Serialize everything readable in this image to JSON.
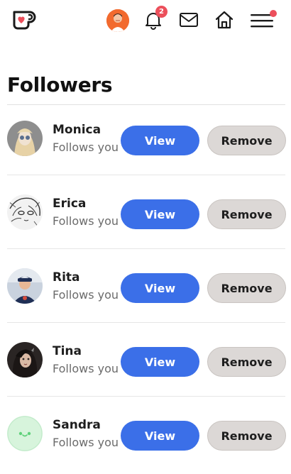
{
  "header": {
    "notification_count": "2",
    "icons": [
      "ko-fi-logo-icon",
      "profile-avatar-icon",
      "bell-icon",
      "mail-icon",
      "home-icon",
      "menu-icon"
    ],
    "accent_color": "#3b6fe8",
    "badge_color": "#ec4f5b"
  },
  "page": {
    "title": "Followers"
  },
  "followers": [
    {
      "name": "Monica",
      "status": "Follows you",
      "view_label": "View",
      "remove_label": "Remove",
      "avatar_color": "#9b9b9b"
    },
    {
      "name": "Erica",
      "status": "Follows you",
      "view_label": "View",
      "remove_label": "Remove",
      "avatar_color": "#e8e8e8"
    },
    {
      "name": "Rita",
      "status": "Follows you",
      "view_label": "View",
      "remove_label": "Remove",
      "avatar_color": "#2d3f63"
    },
    {
      "name": "Tina",
      "status": "Follows you",
      "view_label": "View",
      "remove_label": "Remove",
      "avatar_color": "#3a3432"
    },
    {
      "name": "Sandra",
      "status": "Follows you",
      "view_label": "View",
      "remove_label": "Remove",
      "avatar_color": "#d7f4dc"
    }
  ]
}
